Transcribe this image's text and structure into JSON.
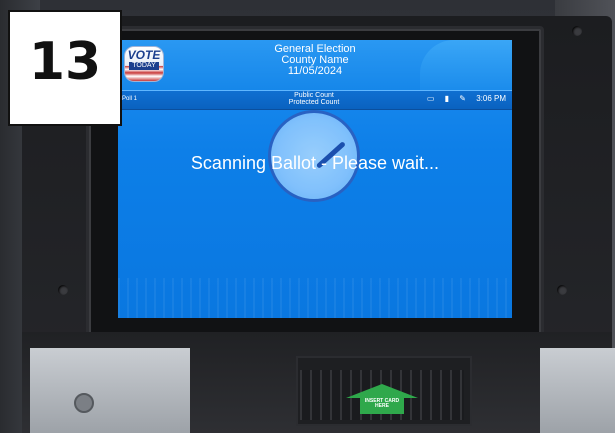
{
  "step_number": "13",
  "header": {
    "line1": "General Election",
    "line2": "County Name",
    "line3": "11/05/2024",
    "logo_line1": "VOTE",
    "logo_line2": "TODAY"
  },
  "statusbar": {
    "left": "Poll 1",
    "mid1": "Public Count",
    "mid2": "Protected Count",
    "time": "3:06 PM",
    "icons": [
      "document-icon",
      "save-icon",
      "pen-icon"
    ]
  },
  "message": "Scanning Ballot - Please wait...",
  "slot_label": "INSERT CARD HERE",
  "colors": {
    "screen": "#0d7fe8",
    "spinner": "#8dc8ff",
    "insert_arrow": "#2fa84b"
  }
}
